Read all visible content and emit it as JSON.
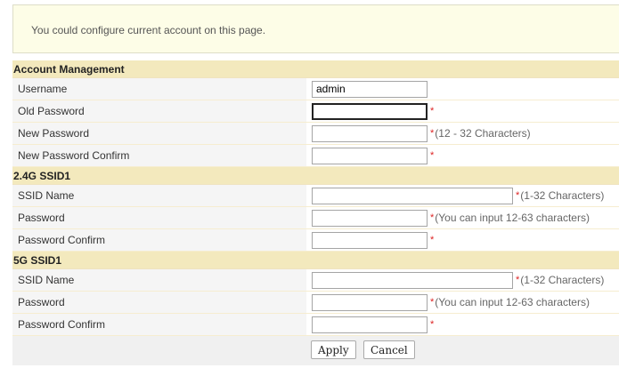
{
  "info": {
    "text": "You could configure current account on this page."
  },
  "account": {
    "title": "Account Management",
    "username_label": "Username",
    "username_value": "admin",
    "old_password_label": "Old Password",
    "new_password_label": "New Password",
    "new_password_hint": "(12 - 32 Characters)",
    "new_password_confirm_label": "New Password Confirm",
    "required_mark": "*"
  },
  "ssid24": {
    "title": "2.4G SSID1",
    "ssid_name_label": "SSID Name",
    "ssid_name_hint": "(1-32 Characters)",
    "password_label": "Password",
    "password_hint": "(You can input 12-63 characters)",
    "password_confirm_label": "Password Confirm"
  },
  "ssid5": {
    "title": "5G SSID1",
    "ssid_name_label": "SSID Name",
    "ssid_name_hint": "(1-32 Characters)",
    "password_label": "Password",
    "password_hint": "(You can input 12-63 characters)",
    "password_confirm_label": "Password Confirm"
  },
  "actions": {
    "apply_label": "Apply",
    "cancel_label": "Cancel"
  },
  "colors": {
    "section_bg": "#f3e9bd",
    "info_bg": "#fdfde7",
    "required": "#dd2222"
  }
}
